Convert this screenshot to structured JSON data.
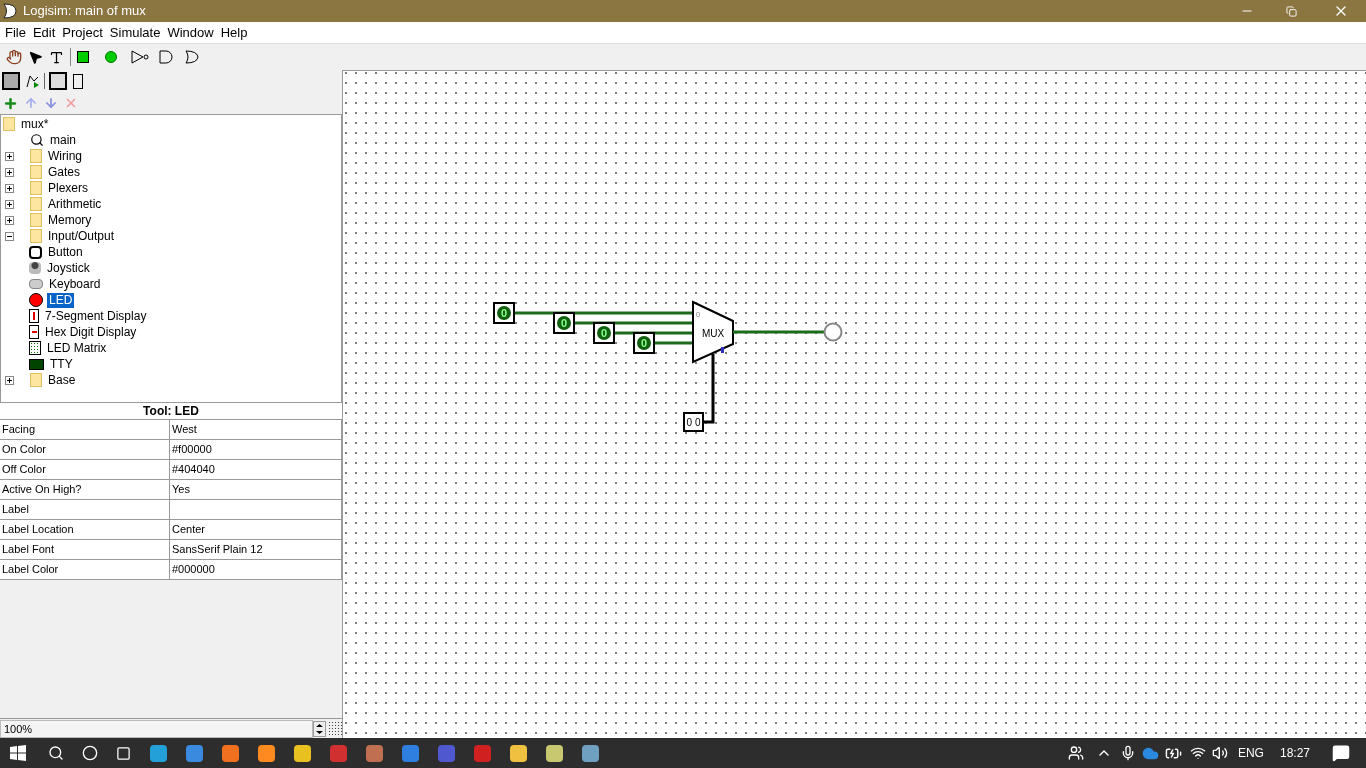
{
  "window": {
    "title": "Logisim: main of mux"
  },
  "menu": [
    "File",
    "Edit",
    "Project",
    "Simulate",
    "Window",
    "Help"
  ],
  "tree": {
    "label": "mux*",
    "kind": "folder",
    "selected": false,
    "children": [
      {
        "label": "main",
        "kind": "circuit",
        "selected": false
      },
      {
        "label": "Wiring",
        "kind": "folder",
        "expanded": false,
        "selected": false
      },
      {
        "label": "Gates",
        "kind": "folder",
        "expanded": false,
        "selected": false
      },
      {
        "label": "Plexers",
        "kind": "folder",
        "expanded": false,
        "selected": false
      },
      {
        "label": "Arithmetic",
        "kind": "folder",
        "expanded": false,
        "selected": false
      },
      {
        "label": "Memory",
        "kind": "folder",
        "expanded": false,
        "selected": false
      },
      {
        "label": "Input/Output",
        "kind": "folder",
        "expanded": true,
        "selected": false,
        "children": [
          {
            "label": "Button",
            "kind": "button",
            "selected": false
          },
          {
            "label": "Joystick",
            "kind": "joystick",
            "selected": false
          },
          {
            "label": "Keyboard",
            "kind": "keyboard",
            "selected": false
          },
          {
            "label": "LED",
            "kind": "led",
            "selected": true
          },
          {
            "label": "7-Segment Display",
            "kind": "seg7",
            "selected": false
          },
          {
            "label": "Hex Digit Display",
            "kind": "hex",
            "selected": false
          },
          {
            "label": "LED Matrix",
            "kind": "matrix",
            "selected": false
          },
          {
            "label": "TTY",
            "kind": "tty",
            "selected": false
          }
        ]
      },
      {
        "label": "Base",
        "kind": "folder",
        "expanded": false,
        "selected": false
      }
    ]
  },
  "attributes": {
    "title": "Tool: LED",
    "rows": [
      {
        "name": "Facing",
        "value": "West"
      },
      {
        "name": "On Color",
        "value": "#f00000"
      },
      {
        "name": "Off Color",
        "value": "#404040"
      },
      {
        "name": "Active On High?",
        "value": "Yes"
      },
      {
        "name": "Label"
      },
      {
        "name": "Label Location",
        "value": "Center"
      },
      {
        "name": "Label Font",
        "value": "SansSerif Plain 12"
      },
      {
        "name": "Label Color",
        "value": "#000000"
      }
    ]
  },
  "zoom": "100%",
  "circuit": {
    "inputs": [
      "0",
      "0",
      "0",
      "0"
    ],
    "mux_label": "MUX",
    "mux_input_label": "0",
    "selector": "0 0",
    "output_led": {
      "on": false
    }
  },
  "taskbar": {
    "language": "ENG",
    "clock": "18:27"
  }
}
